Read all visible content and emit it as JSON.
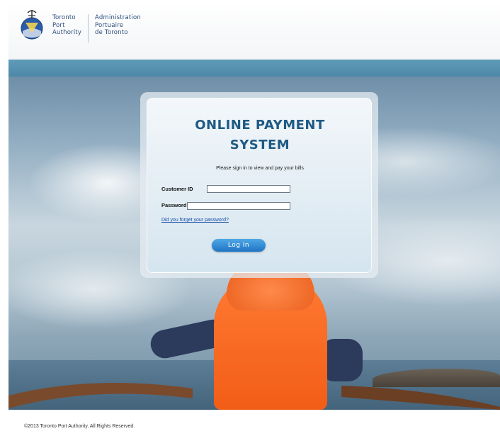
{
  "header": {
    "org_en": [
      "Toronto",
      "Port",
      "Authority"
    ],
    "org_fr": [
      "Administration",
      "Portuaire",
      "de Toronto"
    ],
    "logo_icon": "toronto-port-authority-emblem"
  },
  "login": {
    "title_line1": "ONLINE PAYMENT",
    "title_line2": "SYSTEM",
    "subtitle": "Please sign in to view and pay your bills",
    "customer_id_label": "Customer ID",
    "customer_id_value": "",
    "password_label": "Password",
    "password_value": "",
    "forgot_link": "Did you forget your password?",
    "login_button": "Log In"
  },
  "footer": {
    "copyright": "©2013 Toronto Port Authority. All Rights Reserved."
  },
  "colors": {
    "title": "#1e5a84",
    "header_bar": "#5f9bb9",
    "button": "#2a84d2"
  }
}
